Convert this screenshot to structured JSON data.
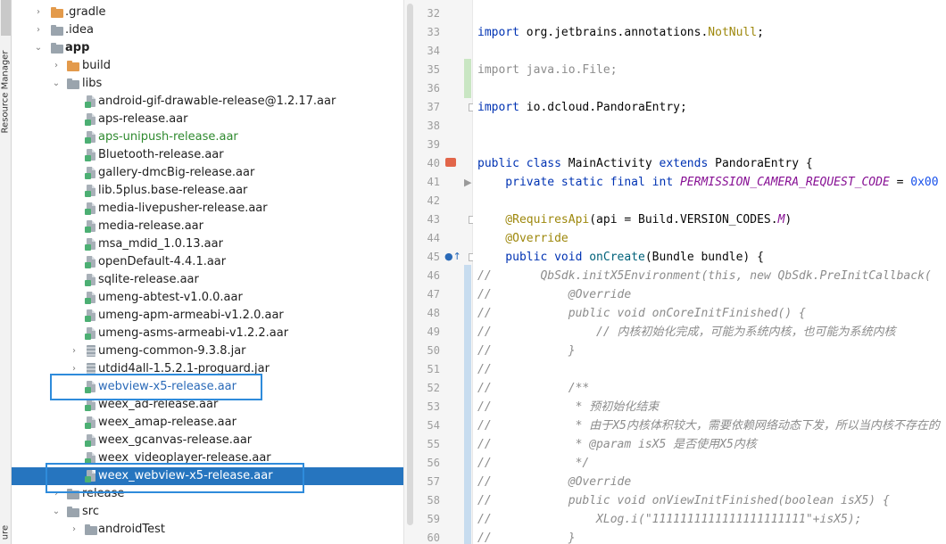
{
  "toolstrip": {
    "label": "Resource Manager",
    "bottom_label": "ure"
  },
  "tree": {
    "rows": [
      {
        "label": ".gradle",
        "kind": "folder-orange",
        "arrow": "›",
        "indent": 1,
        "style": ""
      },
      {
        "label": ".idea",
        "kind": "folder-gray",
        "arrow": "›",
        "indent": 1,
        "style": ""
      },
      {
        "label": "app",
        "kind": "folder-gray",
        "arrow": "⌄",
        "indent": 1,
        "style": "bold"
      },
      {
        "label": "build",
        "kind": "folder-orange",
        "arrow": "›",
        "indent": 2,
        "style": ""
      },
      {
        "label": "libs",
        "kind": "folder-gray",
        "arrow": "⌄",
        "indent": 2,
        "style": ""
      },
      {
        "label": "android-gif-drawable-release@1.2.17.aar",
        "kind": "aar",
        "arrow": "",
        "indent": 3,
        "style": ""
      },
      {
        "label": "aps-release.aar",
        "kind": "aar",
        "arrow": "",
        "indent": 3,
        "style": ""
      },
      {
        "label": "aps-unipush-release.aar",
        "kind": "aar",
        "arrow": "",
        "indent": 3,
        "style": "green"
      },
      {
        "label": "Bluetooth-release.aar",
        "kind": "aar",
        "arrow": "",
        "indent": 3,
        "style": ""
      },
      {
        "label": "gallery-dmcBig-release.aar",
        "kind": "aar",
        "arrow": "",
        "indent": 3,
        "style": ""
      },
      {
        "label": "lib.5plus.base-release.aar",
        "kind": "aar",
        "arrow": "",
        "indent": 3,
        "style": ""
      },
      {
        "label": "media-livepusher-release.aar",
        "kind": "aar",
        "arrow": "",
        "indent": 3,
        "style": ""
      },
      {
        "label": "media-release.aar",
        "kind": "aar",
        "arrow": "",
        "indent": 3,
        "style": ""
      },
      {
        "label": "msa_mdid_1.0.13.aar",
        "kind": "aar",
        "arrow": "",
        "indent": 3,
        "style": ""
      },
      {
        "label": "openDefault-4.4.1.aar",
        "kind": "aar",
        "arrow": "",
        "indent": 3,
        "style": ""
      },
      {
        "label": "sqlite-release.aar",
        "kind": "aar",
        "arrow": "",
        "indent": 3,
        "style": ""
      },
      {
        "label": "umeng-abtest-v1.0.0.aar",
        "kind": "aar",
        "arrow": "",
        "indent": 3,
        "style": ""
      },
      {
        "label": "umeng-apm-armeabi-v1.2.0.aar",
        "kind": "aar",
        "arrow": "",
        "indent": 3,
        "style": ""
      },
      {
        "label": "umeng-asms-armeabi-v1.2.2.aar",
        "kind": "aar",
        "arrow": "",
        "indent": 3,
        "style": ""
      },
      {
        "label": "umeng-common-9.3.8.jar",
        "kind": "jar",
        "arrow": "›",
        "indent": 3,
        "style": ""
      },
      {
        "label": "utdid4all-1.5.2.1-proguard.jar",
        "kind": "jar",
        "arrow": "›",
        "indent": 3,
        "style": ""
      },
      {
        "label": "webview-x5-release.aar",
        "kind": "aar",
        "arrow": "",
        "indent": 3,
        "style": "blue"
      },
      {
        "label": "weex_ad-release.aar",
        "kind": "aar",
        "arrow": "",
        "indent": 3,
        "style": ""
      },
      {
        "label": "weex_amap-release.aar",
        "kind": "aar",
        "arrow": "",
        "indent": 3,
        "style": ""
      },
      {
        "label": "weex_gcanvas-release.aar",
        "kind": "aar",
        "arrow": "",
        "indent": 3,
        "style": ""
      },
      {
        "label": "weex_videoplayer-release.aar",
        "kind": "aar",
        "arrow": "",
        "indent": 3,
        "style": ""
      },
      {
        "label": "weex_webview-x5-release.aar",
        "kind": "aar",
        "arrow": "",
        "indent": 3,
        "style": "selected"
      },
      {
        "label": "release",
        "kind": "folder-gray",
        "arrow": "›",
        "indent": 2,
        "style": ""
      },
      {
        "label": "src",
        "kind": "folder-gray",
        "arrow": "⌄",
        "indent": 2,
        "style": ""
      },
      {
        "label": "androidTest",
        "kind": "folder-gray",
        "arrow": "›",
        "indent": 3,
        "style": ""
      }
    ]
  },
  "editor": {
    "line_numbers": [
      "32",
      "33",
      "34",
      "35",
      "36",
      "37",
      "38",
      "39",
      "40",
      "41",
      "42",
      "43",
      "44",
      "45",
      "46",
      "47",
      "48",
      "49",
      "50",
      "51",
      "52",
      "53",
      "54",
      "55",
      "56",
      "57",
      "58",
      "59",
      "60"
    ],
    "lines": [
      [],
      [
        {
          "t": "import ",
          "c": "kw"
        },
        {
          "t": "org.jetbrains.annotations.",
          "c": ""
        },
        {
          "t": "NotNull",
          "c": "ann"
        },
        {
          "t": ";",
          "c": ""
        }
      ],
      [],
      [
        {
          "t": "import java.io.File;",
          "c": "gry"
        }
      ],
      [],
      [
        {
          "t": "import ",
          "c": "kw"
        },
        {
          "t": "io.dcloud.PandoraEntry;",
          "c": ""
        }
      ],
      [],
      [],
      [
        {
          "t": "public class ",
          "c": "kw"
        },
        {
          "t": "MainActivity ",
          "c": ""
        },
        {
          "t": "extends ",
          "c": "kw"
        },
        {
          "t": "PandoraEntry {",
          "c": ""
        }
      ],
      [
        {
          "t": "    private static final int ",
          "c": "kw"
        },
        {
          "t": "PERMISSION_CAMERA_REQUEST_CODE",
          "c": "cst"
        },
        {
          "t": " = ",
          "c": ""
        },
        {
          "t": "0x00",
          "c": "num"
        }
      ],
      [],
      [
        {
          "t": "    @RequiresApi",
          "c": "ann"
        },
        {
          "t": "(api = Build.VERSION_CODES.",
          "c": ""
        },
        {
          "t": "M",
          "c": "cst"
        },
        {
          "t": ")",
          "c": ""
        }
      ],
      [
        {
          "t": "    @Override",
          "c": "ann"
        }
      ],
      [
        {
          "t": "    public void ",
          "c": "kw"
        },
        {
          "t": "onCreate",
          "c": "fn"
        },
        {
          "t": "(Bundle bundle) {",
          "c": ""
        }
      ],
      [
        {
          "t": "//       QbSdk.initX5Environment(this, new QbSdk.PreInitCallback(",
          "c": "cmt"
        }
      ],
      [
        {
          "t": "//           @Override",
          "c": "cmt"
        }
      ],
      [
        {
          "t": "//           public void onCoreInitFinished() {",
          "c": "cmt"
        }
      ],
      [
        {
          "t": "//               // 内核初始化完成，可能为系统内核，也可能为系统内核",
          "c": "cmt"
        }
      ],
      [
        {
          "t": "//           }",
          "c": "cmt"
        }
      ],
      [
        {
          "t": "//",
          "c": "cmt"
        }
      ],
      [
        {
          "t": "//           /**",
          "c": "cmt"
        }
      ],
      [
        {
          "t": "//            * 预初始化结束",
          "c": "cmt"
        }
      ],
      [
        {
          "t": "//            * 由于X5内核体积较大，需要依赖网络动态下发，所以当内核不存在的",
          "c": "cmt"
        }
      ],
      [
        {
          "t": "//            * @param isX5 是否使用X5内核",
          "c": "cmt"
        }
      ],
      [
        {
          "t": "//            */",
          "c": "cmt"
        }
      ],
      [
        {
          "t": "//           @Override",
          "c": "cmt"
        }
      ],
      [
        {
          "t": "//           public void onViewInitFinished(boolean isX5) {",
          "c": "cmt"
        }
      ],
      [
        {
          "t": "//               XLog.i(\"1111111111111111111111\"+isX5);",
          "c": "cmt"
        }
      ],
      [
        {
          "t": "//           }",
          "c": "cmt"
        }
      ]
    ]
  },
  "colors": {
    "selection": "#2675bf",
    "highlight_box": "#2e8bdb",
    "keyword": "#0033b3",
    "comment": "#8c8c8c"
  }
}
